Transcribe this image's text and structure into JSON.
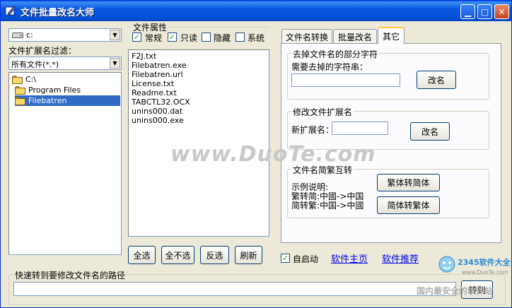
{
  "window": {
    "title": "文件批量改名大师"
  },
  "drive": {
    "selected": "c:"
  },
  "filter": {
    "label": "文件扩展名过滤：",
    "selected": "所有文件(*.*)"
  },
  "tree": {
    "items": [
      "C:\\",
      "Program Files",
      "Filebatren"
    ]
  },
  "attributes": {
    "title": "文件属性",
    "items": [
      {
        "label": "常规",
        "checked": true
      },
      {
        "label": "只读",
        "checked": true
      },
      {
        "label": "隐藏",
        "checked": false
      },
      {
        "label": "系统",
        "checked": false
      }
    ]
  },
  "files": [
    "F2J.txt",
    "Filebatren.exe",
    "Filebatren.url",
    "License.txt",
    "Readme.txt",
    "TABCTL32.OCX",
    "unins000.dat",
    "unins000.exe"
  ],
  "file_buttons": {
    "select_all": "全选",
    "select_none": "全不选",
    "invert": "反选",
    "refresh": "刷新"
  },
  "tabs": [
    {
      "label": "文件名转换",
      "active": false
    },
    {
      "label": "批量改名",
      "active": false
    },
    {
      "label": "其它",
      "active": true
    }
  ],
  "remove_part": {
    "title": "去掉文件名的部分字符",
    "prompt": "需要去掉的字符串：",
    "value": "",
    "button": "改名"
  },
  "change_ext": {
    "title": "修改文件扩展名",
    "prompt": "新扩展名：",
    "value": "",
    "button": "改名"
  },
  "convert": {
    "title": "文件名简繁互转",
    "example_title": "示例说明:",
    "example_t2s": "繁转简:中國->中国",
    "example_s2t": "简转繁:中国->中國",
    "to_simplified": "繁体转简体",
    "to_traditional": "简体转繁体"
  },
  "autostart": {
    "label": "自启动",
    "checked": true
  },
  "links": {
    "homepage": "软件主页",
    "recommend": "软件推荐"
  },
  "quick_path": {
    "label": "快速转到要修改文件名的路径",
    "value": "",
    "button": "转到"
  },
  "watermark": {
    "text": "www.DuoTe.com"
  },
  "stamp": {
    "brand": "2345软件大全",
    "url": "www.DuoTe.com",
    "slogan": "国内最安全的软件站"
  },
  "colors": {
    "title_bar": "#0550d4",
    "selection": "#316ac5",
    "link": "#0000ee",
    "tab_highlight": "#ffc83c"
  }
}
